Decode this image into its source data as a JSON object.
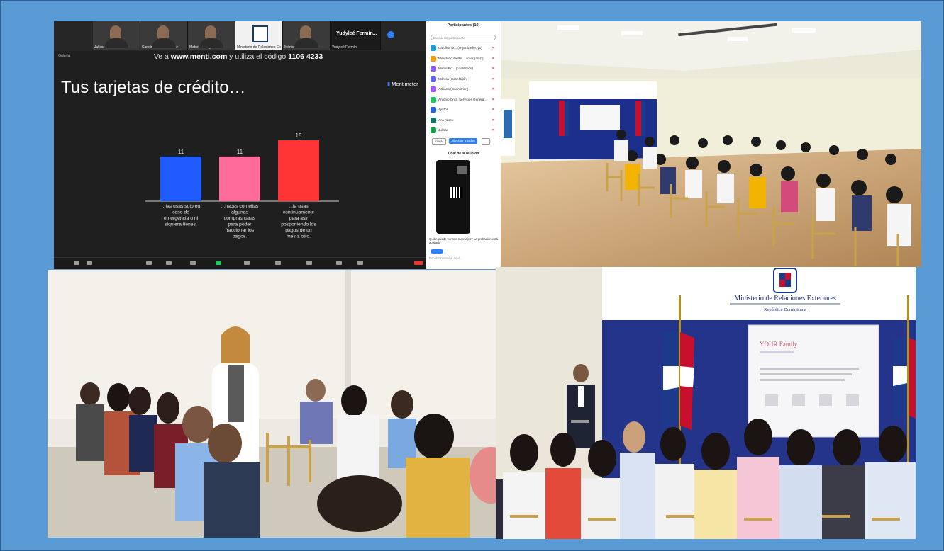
{
  "zoom": {
    "tiles": [
      "Julissa Ureña",
      "Carolina Feliz Ramírez",
      "Mabel Rodríguez",
      "Ministerio de Relaciones Exteriores",
      "Mónica Santos",
      "Yudyleé Fermín"
    ],
    "named_tile": "Yudyleé Fermín...",
    "view_tag": "Galería",
    "hint_prefix": "Ve a",
    "hint_site": "www.menti.com",
    "hint_middle": "y utiliza el código",
    "hint_code": "1106 4233"
  },
  "slide": {
    "title": "Tus tarjetas de crédito…",
    "brand": "Mentimeter"
  },
  "chart_data": {
    "type": "bar",
    "categories": [
      [
        "...las usas solo en",
        "caso de",
        "emergencia o ni",
        "siquiera tienes."
      ],
      [
        "...haces con ellas",
        "algunas",
        "compras caras",
        "para poder",
        "fraccionar los",
        "pagos."
      ],
      [
        "...la usas",
        "continuamente",
        "para asir",
        "posponiendo los",
        "pagos de un",
        "mes a otro."
      ]
    ],
    "values": [
      11,
      11,
      15
    ],
    "colors": [
      "#1f5bff",
      "#ff6b9a",
      "#ff3434"
    ]
  },
  "participants": {
    "title": "Participantes (10)",
    "search": "Buscar un participante",
    "list": [
      {
        "initials": "CI",
        "name": "Carolina M... (organizador, yo)",
        "color": "#1d9bd6"
      },
      {
        "initials": "MR",
        "name": "Ministerio de Rel... (coorganiz.)",
        "color": "#f59e0b"
      },
      {
        "initials": "MS",
        "name": "Mabel Ro... (coanfitrión)",
        "color": "#8b5cf6"
      },
      {
        "initials": "MS",
        "name": "Mónica (Coanfitrión)",
        "color": "#6366f1"
      },
      {
        "initials": "AO",
        "name": "Adriana (Coanfitrión)",
        "color": "#a855f7"
      },
      {
        "initials": "AC",
        "name": "Antonio Cruz, Servicios Genera...",
        "color": "#22c55e"
      },
      {
        "initials": "A",
        "name": "Ajedor",
        "color": "#2563eb"
      },
      {
        "initials": "A",
        "name": "Ana Abreu",
        "color": "#0f766e"
      },
      {
        "initials": "J",
        "name": "Julissa",
        "color": "#16a34a"
      }
    ],
    "invite": "Invitar",
    "mute_all": "Silenciar a todos",
    "chat_title": "Chat de la reunión",
    "chat_note": "Quién puede ver sus mensajes? La grabación está activada",
    "chat_input": "Escribir mensaje aquí..."
  },
  "banner": {
    "ministry": "Ministerio de Relaciones Exteriores",
    "country": "República Dominicana",
    "screen_heading": "YOUR Family"
  }
}
